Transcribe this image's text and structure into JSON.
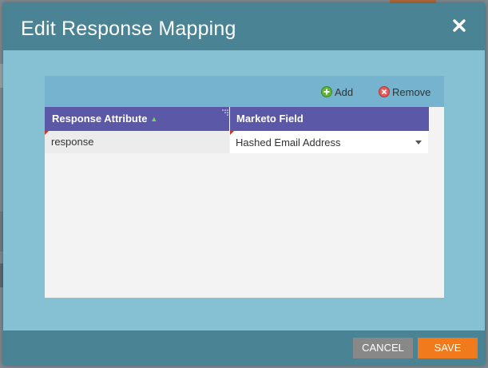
{
  "dialog": {
    "title": "Edit Response Mapping",
    "close_icon": "close-icon"
  },
  "toolbar": {
    "add_label": "Add",
    "add_icon": "plus-circle-icon",
    "remove_label": "Remove",
    "remove_icon": "x-circle-icon"
  },
  "grid": {
    "columns": [
      {
        "label": "Response Attribute"
      },
      {
        "label": "Marketo Field"
      }
    ],
    "rows": [
      {
        "response_attribute": "response",
        "marketo_field": "Hashed Email Address"
      }
    ]
  },
  "footer": {
    "cancel_label": "CANCEL",
    "save_label": "SAVE"
  },
  "colors": {
    "header_bg": "#4a8393",
    "body_bg": "#85c1d2",
    "toolbar_bg": "#75b3cf",
    "grid_header_bg": "#5c58a8",
    "save_button": "#f07a1c",
    "cancel_button": "#888888"
  }
}
